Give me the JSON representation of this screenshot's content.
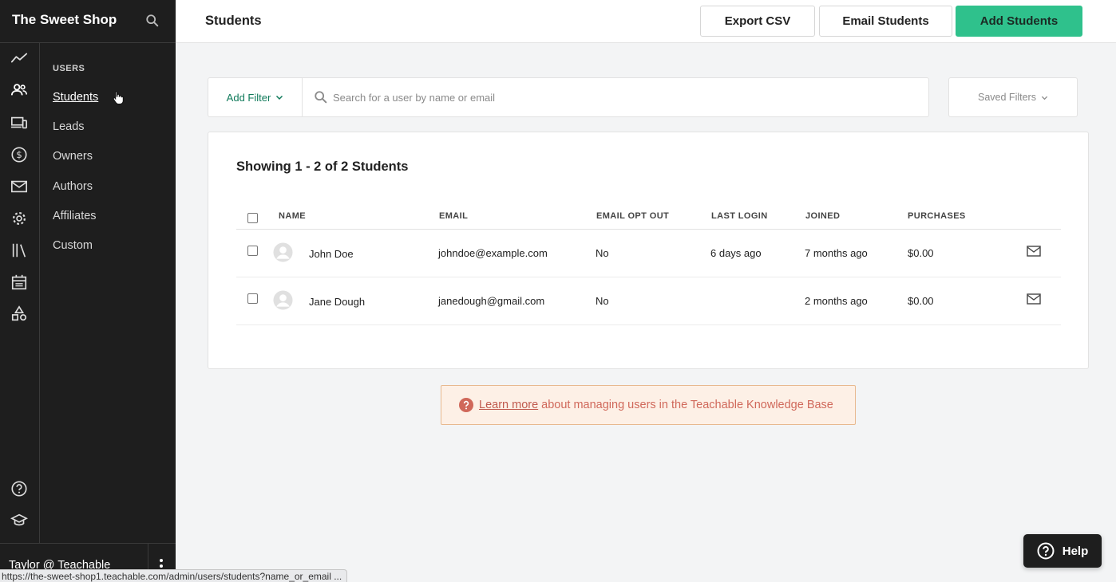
{
  "app": {
    "school_name": "The Sweet Shop"
  },
  "sidebar": {
    "section_title": "USERS",
    "items": [
      {
        "label": "Students",
        "active": true
      },
      {
        "label": "Leads"
      },
      {
        "label": "Owners"
      },
      {
        "label": "Authors"
      },
      {
        "label": "Affiliates"
      },
      {
        "label": "Custom"
      }
    ],
    "rail_icons": [
      "analytics-icon",
      "users-icon",
      "devices-icon",
      "dollar-icon",
      "mail-icon",
      "gear-icon",
      "library-icon",
      "calendar-icon",
      "shapes-icon",
      "help-circle-icon",
      "graduation-cap-icon"
    ],
    "user_name": "Taylor @ Teachable"
  },
  "statusbar": {
    "url": "https://the-sweet-shop1.teachable.com/admin/users/students?name_or_email ..."
  },
  "header": {
    "title": "Students",
    "export_label": "Export CSV",
    "email_label": "Email Students",
    "add_label": "Add Students"
  },
  "filters": {
    "add_filter_label": "Add Filter",
    "search_placeholder": "Search for a user by name or email",
    "saved_filters_label": "Saved Filters"
  },
  "table": {
    "showing": "Showing 1 - 2 of 2 Students",
    "columns": {
      "name": "NAME",
      "email": "EMAIL",
      "opt_out": "EMAIL OPT OUT",
      "last_login": "LAST LOGIN",
      "joined": "JOINED",
      "purchases": "PURCHASES"
    },
    "rows": [
      {
        "name": "John Doe",
        "email": "johndoe@example.com",
        "opt_out": "No",
        "last_login": "6 days ago",
        "joined": "7 months ago",
        "purchases": "$0.00"
      },
      {
        "name": "Jane Dough",
        "email": "janedough@gmail.com",
        "opt_out": "No",
        "last_login": "",
        "joined": "2 months ago",
        "purchases": "$0.00"
      }
    ]
  },
  "kb_banner": {
    "link_text": "Learn more",
    "text": "about managing users in the Teachable Knowledge Base"
  },
  "help": {
    "label": "Help"
  },
  "colors": {
    "primary_green": "#2fc18c",
    "sidebar_bg": "#1e1e1e",
    "banner_bg": "#fdf0e6",
    "banner_text": "#d0685a"
  }
}
